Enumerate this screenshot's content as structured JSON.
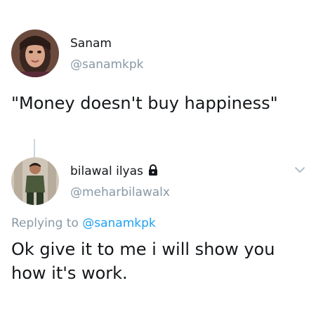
{
  "tweet1": {
    "name": "Sanam",
    "handle": "@sanamkpk",
    "text": "\"Money doesn't buy happiness\"",
    "avatar_icon": "profile-photo-woman"
  },
  "tweet2": {
    "name": "bilawal ilyas",
    "handle": "@meharbilawalx",
    "protected_icon": "lock-icon",
    "menu_icon": "chevron-down-icon",
    "replying_prefix": "Replying to",
    "replying_to": "@sanamkpk",
    "text": "Ok give it to me i will show you how it's work.",
    "avatar_icon": "profile-photo-man"
  },
  "colors": {
    "text": "#14171a",
    "muted": "#8899a6",
    "link": "#1da1f2",
    "thread_line": "#ccd6dd"
  }
}
